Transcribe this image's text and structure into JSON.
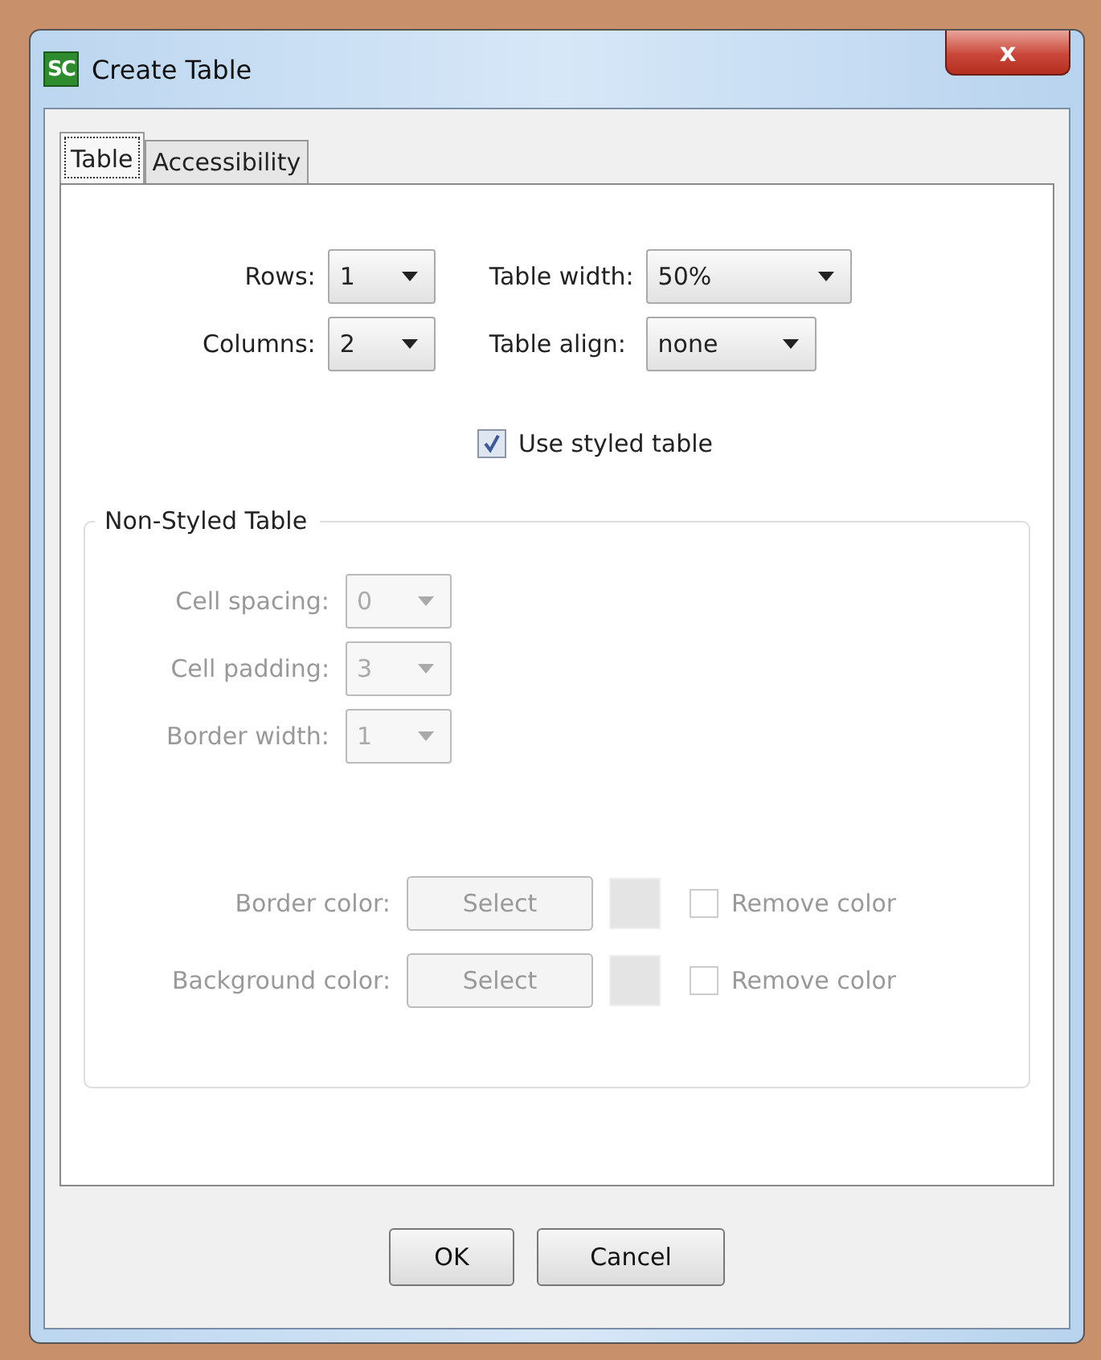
{
  "window": {
    "title": "Create Table",
    "app_icon_text": "SC",
    "close_glyph": "x"
  },
  "tabs": [
    {
      "label": "Table",
      "selected": true
    },
    {
      "label": "Accessibility",
      "selected": false
    }
  ],
  "top_fields": [
    {
      "label": "Rows:",
      "value": "1"
    },
    {
      "label": "Table width:",
      "value": "50%"
    },
    {
      "label": "Columns:",
      "value": "2"
    },
    {
      "label": "Table align:",
      "value": "none"
    }
  ],
  "use_styled_table": {
    "label": "Use styled table",
    "checked": true
  },
  "non_styled_group": {
    "title": "Non-Styled Table",
    "selects": [
      {
        "label": "Cell spacing:",
        "value": "0",
        "disabled": true
      },
      {
        "label": "Cell padding:",
        "value": "3",
        "disabled": true
      },
      {
        "label": "Border width:",
        "value": "1",
        "disabled": true
      }
    ],
    "colors": [
      {
        "label": "Border color:",
        "button": "Select",
        "remove_label": "Remove color",
        "checked": false,
        "disabled": true
      },
      {
        "label": "Background color:",
        "button": "Select",
        "remove_label": "Remove color",
        "checked": false,
        "disabled": true
      }
    ]
  },
  "buttons": [
    "OK",
    "Cancel"
  ]
}
